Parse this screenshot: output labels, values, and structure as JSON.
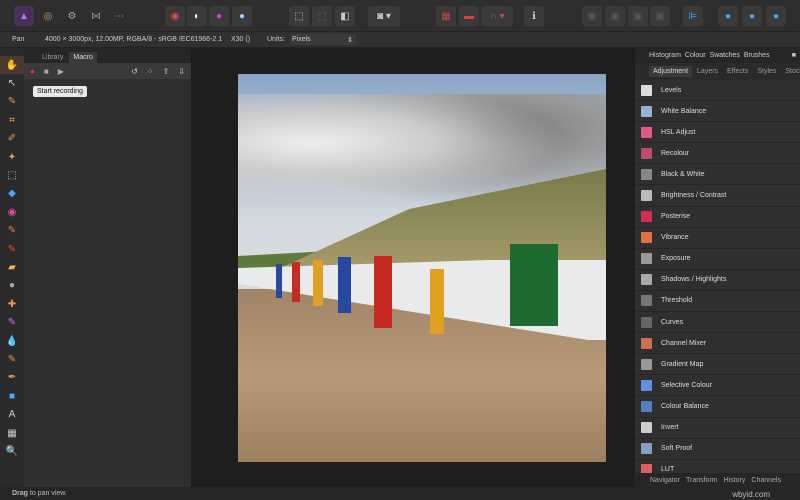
{
  "toolbar": {
    "personas": [
      "photo-persona",
      "liquify-persona",
      "develop-persona",
      "tone-mapping-persona",
      "export-persona"
    ],
    "units_dropdown": "Pixels"
  },
  "context": {
    "tool": "Pan",
    "doc_info": "4000 × 3000px, 12.00MP, RGBA/8 - sRGB IEC61966-2.1",
    "camera": "X30 ()",
    "units_label": "Units:",
    "units_value": "Pixels"
  },
  "left_panel": {
    "tabs": [
      "Library",
      "Macro"
    ],
    "active_tab": "Macro",
    "tooltip": "Start recording"
  },
  "right_panel": {
    "top_tabs": [
      "Histogram",
      "Colour",
      "Swatches",
      "Brushes"
    ],
    "tabs": [
      "Adjustment",
      "Layers",
      "Effects",
      "Styles",
      "Stock"
    ],
    "active_tab": "Adjustment",
    "adjustments": [
      {
        "label": "Levels",
        "color": "#ddd"
      },
      {
        "label": "White Balance",
        "color": "#9ab0d0"
      },
      {
        "label": "HSL Adjust",
        "color": "#e05a8a"
      },
      {
        "label": "Recolour",
        "color": "#c04a6a"
      },
      {
        "label": "Black & White",
        "color": "#888"
      },
      {
        "label": "Brightness / Contrast",
        "color": "#bbb"
      },
      {
        "label": "Posterise",
        "color": "#d03050"
      },
      {
        "label": "Vibrance",
        "color": "#e07040"
      },
      {
        "label": "Exposure",
        "color": "#999"
      },
      {
        "label": "Shadows / Highlights",
        "color": "#aaa"
      },
      {
        "label": "Threshold",
        "color": "#777"
      },
      {
        "label": "Curves",
        "color": "#666"
      },
      {
        "label": "Channel Mixer",
        "color": "#d07050"
      },
      {
        "label": "Gradient Map",
        "color": "#999"
      },
      {
        "label": "Selective Colour",
        "color": "#6090e0"
      },
      {
        "label": "Colour Balance",
        "color": "#5080c0"
      },
      {
        "label": "Invert",
        "color": "#ccc"
      },
      {
        "label": "Soft Proof",
        "color": "#8aa0c0"
      },
      {
        "label": "LUT",
        "color": "#e06060"
      }
    ],
    "bottom_tabs": [
      "Navigator",
      "Transform",
      "History",
      "Channels"
    ]
  },
  "status": {
    "hint_bold": "Drag",
    "hint": " to pan view."
  },
  "watermark": "wbyid.com"
}
